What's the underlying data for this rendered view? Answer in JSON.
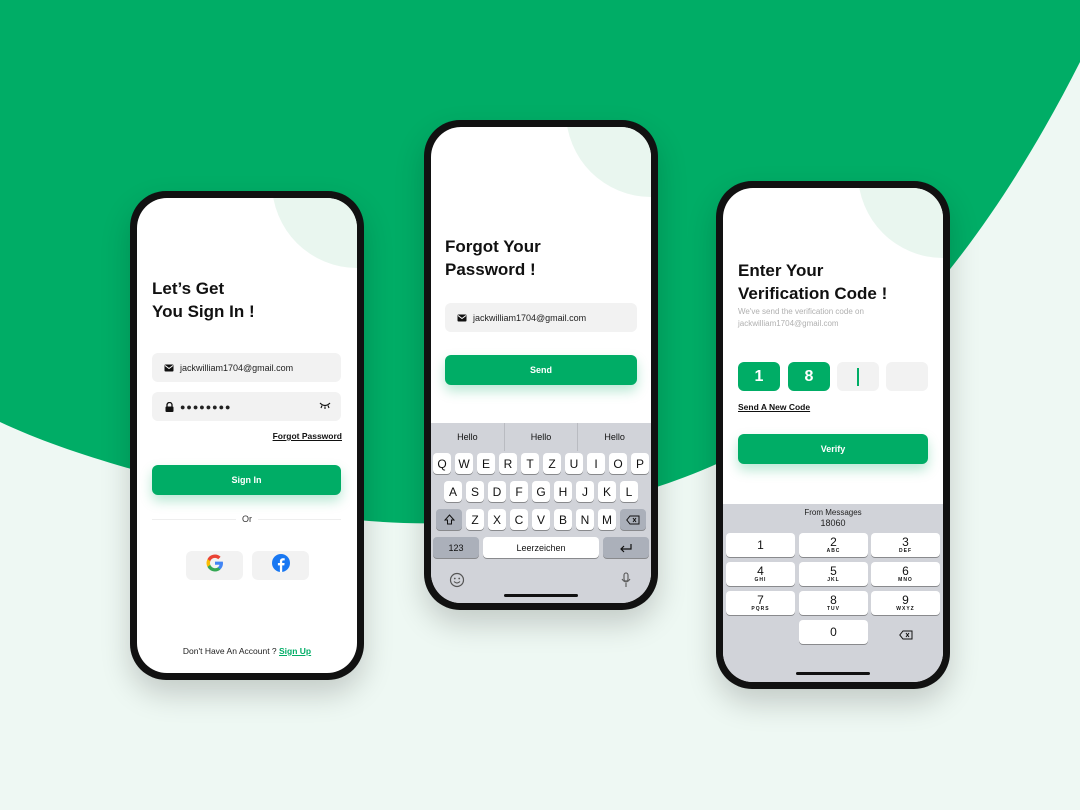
{
  "colors": {
    "brand": "#00ad66",
    "background": "#eef8f3",
    "field": "#f2f2f2",
    "keyboard": "#d1d3d9"
  },
  "signin": {
    "title_line1": "Let’s Get",
    "title_line2": "You Sign In !",
    "email": "jackwilliam1704@gmail.com",
    "password_masked": "●●●●●●●●",
    "forgot_label": "Forgot Password",
    "signin_label": "Sign In",
    "or_label": "Or",
    "no_account": "Don't Have An Account ? ",
    "signup_label": "Sign Up",
    "icons": [
      "mail-icon",
      "lock-icon",
      "eye-closed-icon",
      "google-icon",
      "facebook-icon"
    ]
  },
  "forgot": {
    "title_line1": "Forgot Your",
    "title_line2": "Password !",
    "email": "jackwilliam1704@gmail.com",
    "send_label": "Send",
    "suggestions": [
      "Hello",
      "Hello",
      "Hello"
    ],
    "row1": [
      "Q",
      "W",
      "E",
      "R",
      "T",
      "Z",
      "U",
      "I",
      "O",
      "P"
    ],
    "row2": [
      "A",
      "S",
      "D",
      "F",
      "G",
      "H",
      "J",
      "K",
      "L"
    ],
    "row3": [
      "Z",
      "X",
      "C",
      "V",
      "B",
      "N",
      "M"
    ],
    "numbers_key": "123",
    "space_key": "Leerzeichen",
    "icons": [
      "shift-icon",
      "backspace-icon",
      "return-icon",
      "emoji-icon",
      "microphone-icon"
    ]
  },
  "verify": {
    "title_line1": "Enter Your",
    "title_line2": "Verification Code !",
    "subtitle_line1": "We've send the verification code on",
    "subtitle_line2": "jackwilliam1704@gmail.com",
    "digits": [
      "1",
      "8",
      "",
      ""
    ],
    "resend_label": "Send A New Code",
    "verify_label": "Verify",
    "autofill_from": "From Messages",
    "autofill_code": "18060",
    "numpad": [
      {
        "n": "1",
        "s": ""
      },
      {
        "n": "2",
        "s": "ABC"
      },
      {
        "n": "3",
        "s": "DEF"
      },
      {
        "n": "4",
        "s": "GHI"
      },
      {
        "n": "5",
        "s": "JKL"
      },
      {
        "n": "6",
        "s": "MNO"
      },
      {
        "n": "7",
        "s": "PQRS"
      },
      {
        "n": "8",
        "s": "TUV"
      },
      {
        "n": "9",
        "s": "WXYZ"
      }
    ],
    "zero": "0"
  }
}
